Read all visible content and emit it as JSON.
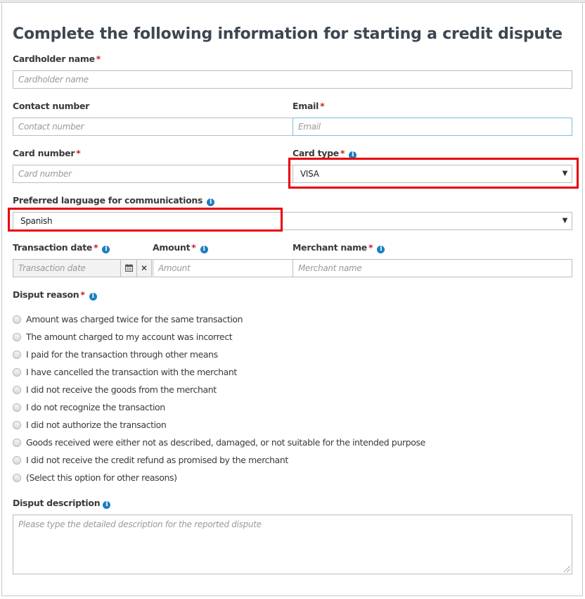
{
  "form": {
    "title": "Complete the following information for starting a credit dispute",
    "required_marker": "*",
    "info_icon": "i",
    "cardholder_name": {
      "label": "Cardholder name",
      "placeholder": "Cardholder name",
      "value": ""
    },
    "contact_number": {
      "label": "Contact number",
      "placeholder": "Contact number",
      "value": ""
    },
    "email": {
      "label": "Email",
      "placeholder": "Email",
      "value": ""
    },
    "card_number": {
      "label": "Card number",
      "placeholder": "Card number",
      "value": ""
    },
    "card_type": {
      "label": "Card type",
      "selected": "VISA"
    },
    "preferred_language": {
      "label": "Preferred language for communications",
      "selected": "Spanish"
    },
    "transaction_date": {
      "label": "Transaction date",
      "placeholder": "Transaction date",
      "calendar_icon": "calendar-icon",
      "clear_label": "✕"
    },
    "amount": {
      "label": "Amount",
      "placeholder": "Amount"
    },
    "merchant_name": {
      "label": "Merchant name",
      "placeholder": "Merchant name"
    },
    "dispute_reason": {
      "label": "Disput reason",
      "options": [
        "Amount was charged twice for the same transaction",
        "The amount charged to my account was incorrect",
        "I paid for the transaction through other means",
        "I have cancelled the transaction with the merchant",
        "I did not receive the goods from the merchant",
        "I do not recognize the transaction",
        "I did not authorize the transaction",
        "Goods received were either not as described, damaged, or not suitable for the intended purpose",
        "I did not receive the credit refund as promised by the merchant",
        "(Select this option for other reasons)"
      ]
    },
    "dispute_description": {
      "label": "Disput description",
      "placeholder": "Please type the detailed description for the reported dispute"
    }
  },
  "colors": {
    "required": "#c0262d",
    "info": "#1a7fc1",
    "highlight": "#e8000b",
    "title": "#3d4651"
  }
}
